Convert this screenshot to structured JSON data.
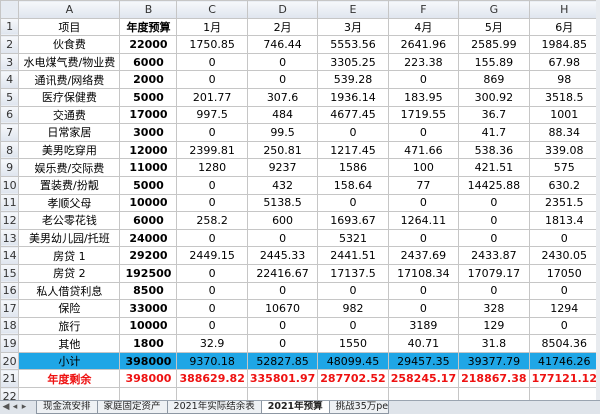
{
  "columns": [
    "A",
    "B",
    "C",
    "D",
    "E",
    "F",
    "G",
    "H"
  ],
  "header_row": {
    "num": "1",
    "label": "项目",
    "budget": "年度预算",
    "months": [
      "1月",
      "2月",
      "3月",
      "4月",
      "5月",
      "6月"
    ]
  },
  "rows": [
    {
      "num": "2",
      "label": "伙食费",
      "budget": "22000",
      "months": [
        "1750.85",
        "746.44",
        "5553.56",
        "2641.96",
        "2585.99",
        "1984.85"
      ]
    },
    {
      "num": "3",
      "label": "水电煤气费/物业费",
      "budget": "6000",
      "months": [
        "0",
        "0",
        "3305.25",
        "223.38",
        "155.89",
        "67.98"
      ]
    },
    {
      "num": "4",
      "label": "通讯费/网络费",
      "budget": "2000",
      "months": [
        "0",
        "0",
        "539.28",
        "0",
        "869",
        "98"
      ]
    },
    {
      "num": "5",
      "label": "医疗保健费",
      "budget": "5000",
      "months": [
        "201.77",
        "307.6",
        "1936.14",
        "183.95",
        "300.92",
        "3518.5"
      ]
    },
    {
      "num": "6",
      "label": "交通费",
      "budget": "17000",
      "months": [
        "997.5",
        "484",
        "4677.45",
        "1719.55",
        "36.7",
        "1001"
      ]
    },
    {
      "num": "7",
      "label": "日常家居",
      "budget": "3000",
      "months": [
        "0",
        "99.5",
        "0",
        "0",
        "41.7",
        "88.34"
      ]
    },
    {
      "num": "8",
      "label": "美男吃穿用",
      "budget": "12000",
      "months": [
        "2399.81",
        "250.81",
        "1217.45",
        "471.66",
        "538.36",
        "339.08"
      ]
    },
    {
      "num": "9",
      "label": "娱乐费/交际费",
      "budget": "11000",
      "months": [
        "1280",
        "9237",
        "1586",
        "100",
        "421.51",
        "575"
      ]
    },
    {
      "num": "10",
      "label": "置装费/扮靓",
      "budget": "5000",
      "months": [
        "0",
        "432",
        "158.64",
        "77",
        "14425.88",
        "630.2"
      ]
    },
    {
      "num": "11",
      "label": "孝顺父母",
      "budget": "10000",
      "months": [
        "0",
        "5138.5",
        "0",
        "0",
        "0",
        "2351.5"
      ]
    },
    {
      "num": "12",
      "label": "老公零花钱",
      "budget": "6000",
      "months": [
        "258.2",
        "600",
        "1693.67",
        "1264.11",
        "0",
        "1813.4"
      ]
    },
    {
      "num": "13",
      "label": "美男幼儿园/托班",
      "budget": "24000",
      "months": [
        "0",
        "0",
        "5321",
        "0",
        "0",
        "0"
      ]
    },
    {
      "num": "14",
      "label": "房贷 1",
      "budget": "29200",
      "months": [
        "2449.15",
        "2445.33",
        "2441.51",
        "2437.69",
        "2433.87",
        "2430.05"
      ]
    },
    {
      "num": "15",
      "label": "房贷 2",
      "budget": "192500",
      "months": [
        "0",
        "22416.67",
        "17137.5",
        "17108.34",
        "17079.17",
        "17050"
      ]
    },
    {
      "num": "16",
      "label": "私人借贷利息",
      "budget": "8500",
      "months": [
        "0",
        "0",
        "0",
        "0",
        "0",
        "0"
      ]
    },
    {
      "num": "17",
      "label": "保险",
      "budget": "33000",
      "months": [
        "0",
        "10670",
        "982",
        "0",
        "328",
        "1294"
      ]
    },
    {
      "num": "18",
      "label": "旅行",
      "budget": "10000",
      "months": [
        "0",
        "0",
        "0",
        "3189",
        "129",
        "0"
      ]
    },
    {
      "num": "19",
      "label": "其他",
      "budget": "1800",
      "months": [
        "32.9",
        "0",
        "1550",
        "40.71",
        "31.8",
        "8504.36"
      ]
    }
  ],
  "subtotal": {
    "num": "20",
    "label": "小计",
    "budget": "398000",
    "months": [
      "9370.18",
      "52827.85",
      "48099.45",
      "29457.35",
      "39377.79",
      "41746.26"
    ]
  },
  "remaining": {
    "num": "21",
    "label": "年度剩余",
    "budget": "398000",
    "months": [
      "388629.82",
      "335801.97",
      "287702.52",
      "258245.17",
      "218867.38",
      "177121.12"
    ]
  },
  "empty_row": {
    "num": "22"
  },
  "tabs": [
    "现金流安排",
    "家庭固定资产",
    "2021年实际结余表",
    "2021年预算",
    "挑战35万per年"
  ],
  "active_tab_index": 3,
  "colors": {
    "subtotal_fill": "#1fa6e6",
    "remaining_text": "#ee1111",
    "header_fill": "#dfe5ee"
  }
}
